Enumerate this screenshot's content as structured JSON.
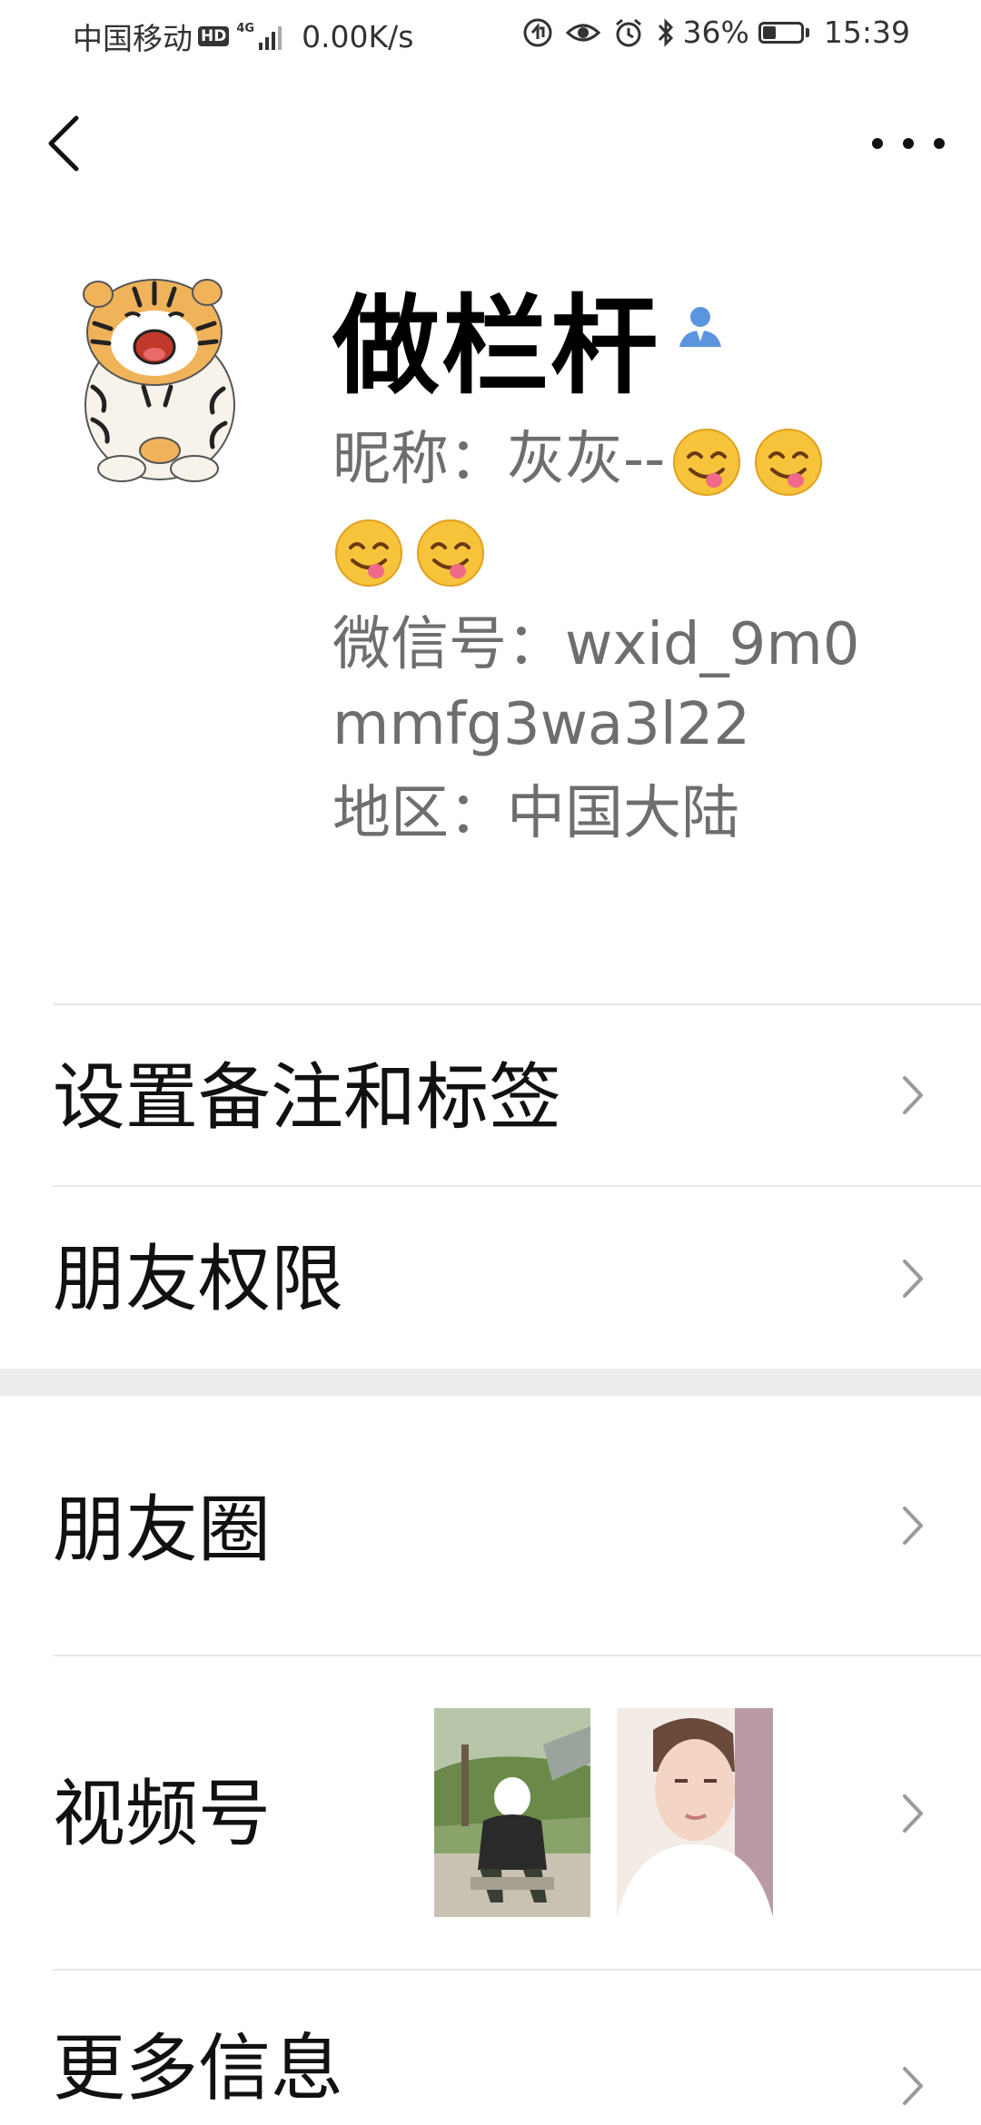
{
  "status_bar": {
    "carrier": "中国移动",
    "hd": "HD",
    "network": "4G",
    "speed": "0.00K/s",
    "battery": "36%",
    "battery_level": 0.36,
    "time": "15:39"
  },
  "profile": {
    "name": "做栏杆",
    "nickname_label": "昵称：",
    "nickname_text": "灰灰--",
    "wxid_label": "微信号：",
    "wxid": "wxid_9m0mmfg3wa3l22",
    "region_label": "地区：",
    "region": "中国大陆"
  },
  "menu": {
    "remark_tags": "设置备注和标签",
    "friend_permissions": "朋友权限",
    "moments": "朋友圈",
    "channels": "视频号",
    "more_info": "更多信息"
  },
  "colors": {
    "background": "#ffffff",
    "section_gap": "#ededed",
    "divider": "#e8e8e8",
    "secondary_text": "#6e6e6e",
    "contact_icon": "#5b95e0"
  },
  "icons": [
    "back-icon",
    "more-icon",
    "contact-icon",
    "chevron-right-icon",
    "smiling-emoji-icon"
  ]
}
